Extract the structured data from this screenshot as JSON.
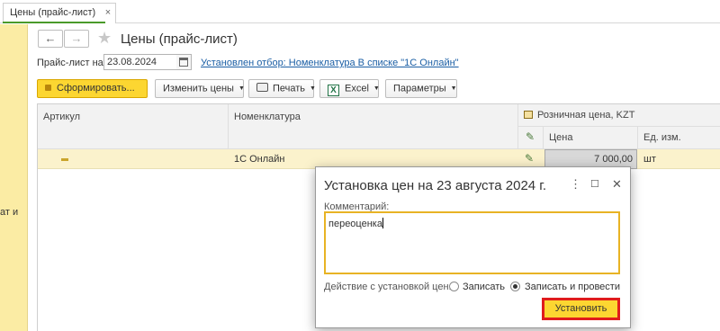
{
  "tab": {
    "label": "Цены (прайс-лист)",
    "close": "×"
  },
  "left_panel": {
    "fragment_text": "ат и"
  },
  "header": {
    "back": "←",
    "forward": "→",
    "star": "★",
    "title": "Цены (прайс-лист)"
  },
  "filter_row": {
    "label": "Прайс-лист на:",
    "date": "23.08.2024",
    "filter_link": "Установлен отбор: Номенклатура В списке \"1С Онлайн\""
  },
  "toolbar": {
    "generate": "Сформировать...",
    "change_prices": "Изменить цены",
    "print": "Печать",
    "excel": "Excel",
    "parameters": "Параметры"
  },
  "table": {
    "columns": {
      "article": "Артикул",
      "nomenclature": "Номенклатура",
      "price_group": "Розничная цена, KZT",
      "price": "Цена",
      "unit": "Ед. изм."
    },
    "rows": [
      {
        "article": "",
        "nomenclature": "1С Онлайн",
        "price": "7 000,00",
        "unit": "шт"
      }
    ]
  },
  "dialog": {
    "title": "Установка цен на 23 августа 2024 г.",
    "menu": "⋮",
    "maximize": "☐",
    "close": "✕",
    "comment_label": "Комментарий:",
    "comment_value": "переоценка",
    "action_label": "Действие с установкой цен:",
    "options": [
      "Записать",
      "Записать и провести"
    ],
    "selected_option": "Записать и провести",
    "apply": "Установить"
  },
  "colors": {
    "accent_yellow": "#fcd631",
    "link": "#1b5fa5",
    "highlight_row": "#fbf2cc",
    "focus_border": "#e8b324",
    "alert_border": "#e01c1c"
  }
}
